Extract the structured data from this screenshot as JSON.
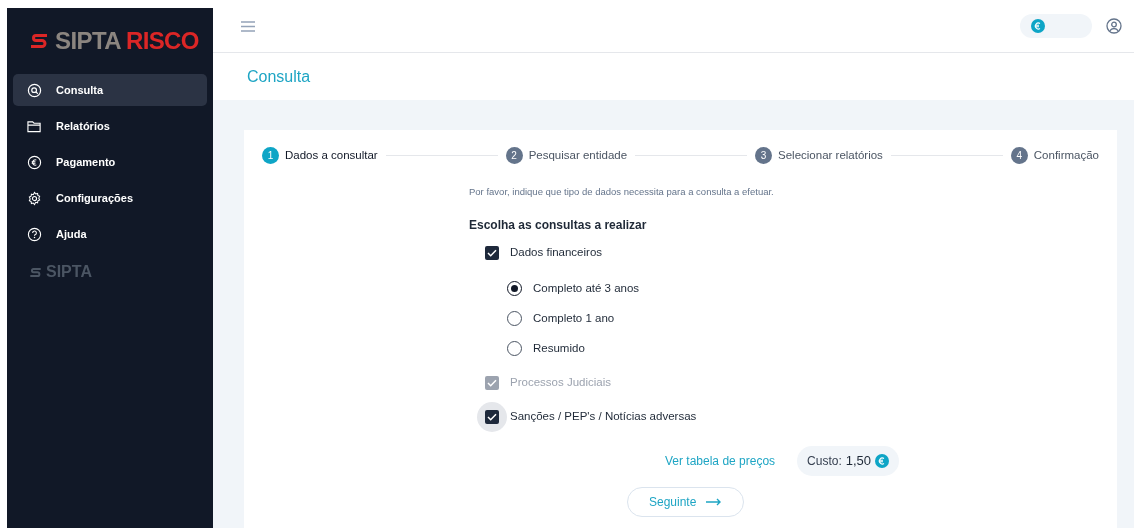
{
  "sidebar": {
    "logo": {
      "brand": "SIPTA",
      "product": "RISCO"
    },
    "items": [
      {
        "label": "Consulta",
        "selected": true
      },
      {
        "label": "Relatórios",
        "selected": false
      },
      {
        "label": "Pagamento",
        "selected": false
      },
      {
        "label": "Configurações",
        "selected": false
      },
      {
        "label": "Ajuda",
        "selected": false
      }
    ],
    "footer_logo": "SIPTA"
  },
  "page_title": "Consulta",
  "steps": [
    {
      "number": "1",
      "label": "Dados a consultar",
      "selected": true
    },
    {
      "number": "2",
      "label": "Pesquisar entidade",
      "selected": false
    },
    {
      "number": "3",
      "label": "Selecionar relatórios",
      "selected": false
    },
    {
      "number": "4",
      "label": "Confirmação",
      "selected": false
    }
  ],
  "intro": "Por favor, indique que tipo de dados necessita para a consulta a efetuar.",
  "section_title": "Escolha as consultas a realizar",
  "options": [
    {
      "kind": "checkbox",
      "label": "Dados financeiros",
      "checked": true,
      "disabled": false,
      "focused": false,
      "children": [
        {
          "kind": "radio",
          "label": "Completo até 3 anos",
          "selected": true
        },
        {
          "kind": "radio",
          "label": "Completo 1 ano",
          "selected": false
        },
        {
          "kind": "radio",
          "label": "Resumido",
          "selected": false
        }
      ]
    },
    {
      "kind": "checkbox",
      "label": "Processos Judiciais",
      "checked": true,
      "disabled": true,
      "focused": false
    },
    {
      "kind": "checkbox",
      "label": "Sanções / PEP's / Notícias adversas",
      "checked": true,
      "disabled": false,
      "focused": true
    }
  ],
  "price_link": "Ver tabela de preços",
  "cost": {
    "label": "Custo:",
    "value": "1,50"
  },
  "next_button": "Seguinte"
}
